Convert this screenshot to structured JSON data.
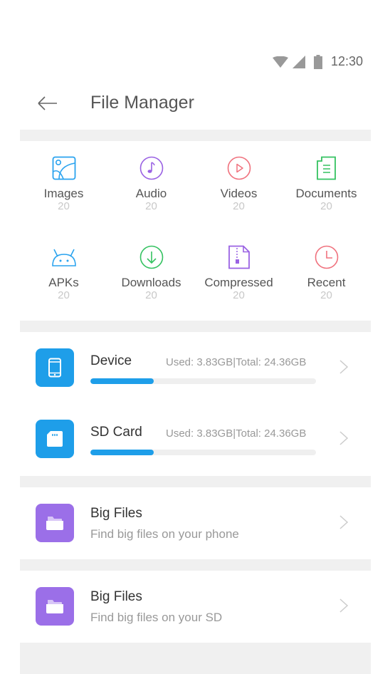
{
  "status_bar": {
    "time": "12:30",
    "icons": [
      "wifi-icon",
      "cell-signal-icon",
      "battery-icon"
    ]
  },
  "app_bar": {
    "back_icon": "arrow-left-icon",
    "title": "File Manager"
  },
  "categories": [
    {
      "label": "Images",
      "count": "20",
      "icon": "image-icon",
      "color": "#2aa3ef"
    },
    {
      "label": "Audio",
      "count": "20",
      "icon": "music-note-icon",
      "color": "#9a62e3"
    },
    {
      "label": "Videos",
      "count": "20",
      "icon": "play-icon",
      "color": "#f0727e"
    },
    {
      "label": "Documents",
      "count": "20",
      "icon": "document-icon",
      "color": "#35c261"
    },
    {
      "label": "APKs",
      "count": "20",
      "icon": "android-icon",
      "color": "#2aa3ef"
    },
    {
      "label": "Downloads",
      "count": "20",
      "icon": "download-icon",
      "color": "#35c261"
    },
    {
      "label": "Compressed",
      "count": "20",
      "icon": "zip-file-icon",
      "color": "#9a62e3"
    },
    {
      "label": "Recent",
      "count": "20",
      "icon": "clock-icon",
      "color": "#f0727e"
    }
  ],
  "storage": [
    {
      "name": "Device",
      "usage": "Used: 3.83GB|Total: 24.36GB",
      "fill_fraction": 0.28,
      "icon": "phone-icon",
      "color": "#1e9ee9"
    },
    {
      "name": "SD Card",
      "usage": "Used: 3.83GB|Total: 24.36GB",
      "fill_fraction": 0.28,
      "icon": "sd-card-icon",
      "color": "#1e9ee9"
    }
  ],
  "tools": [
    {
      "title": "Big Files",
      "subtitle": "Find big files on your phone",
      "icon": "folder-icon",
      "color": "#9b6fe8"
    },
    {
      "title": "Big Files",
      "subtitle": "Find big files on your SD",
      "icon": "folder-icon",
      "color": "#9b6fe8"
    }
  ],
  "colors": {
    "accent_blue": "#1e9ee9",
    "purple": "#9b6fe8",
    "divider": "#f0f0f0"
  }
}
